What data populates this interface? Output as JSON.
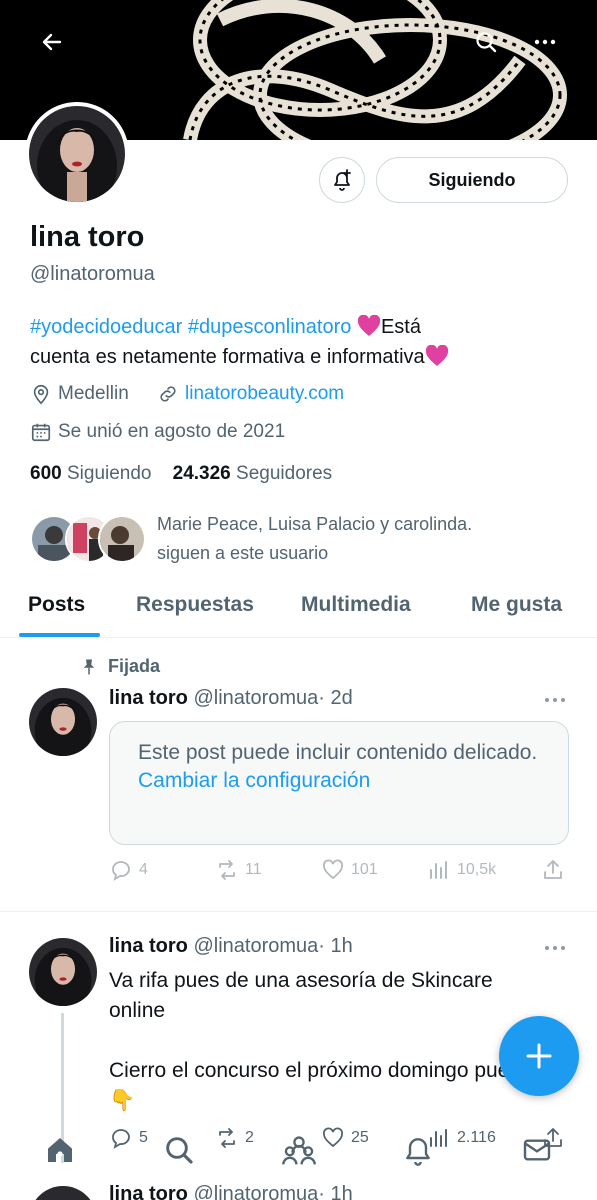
{
  "profile": {
    "name": "lina toro",
    "handle": "@linatoromua",
    "following_button": "Siguiendo",
    "bio_tag1": "#yodecidoeducar",
    "bio_tag2": "#dupesconlinatoro",
    "bio_text1": "Está",
    "bio_text2": "cuenta es netamente formativa e informativa",
    "location": "Medellin",
    "website": "linatorobeauty.com",
    "joined": "Se unió en agosto de 2021",
    "following_count": "600",
    "following_label": "Siguiendo",
    "followers_count": "24.326",
    "followers_label": "Seguidores",
    "followers_you_know_line1": "Marie Peace, Luisa Palacio y carolinda.",
    "followers_you_know_line2": "siguen a este usuario"
  },
  "tabs": [
    "Posts",
    "Respuestas",
    "Multimedia",
    "Me gusta"
  ],
  "posts": [
    {
      "pinned_label": "Fijada",
      "name": "lina toro",
      "handle": "@linatoromua",
      "time": "· 2d",
      "sensitive_text": "Este post puede incluir contenido delicado.",
      "sensitive_action": "Cambiar la configuración",
      "replies": "4",
      "reposts": "11",
      "likes": "101",
      "views": "10,5k"
    },
    {
      "name": "lina toro",
      "handle": "@linatoromua",
      "time": "· 1h",
      "text_line1": "Va rifa pues de una asesoría de Skincare online",
      "text_line2": "Cierro el concurso el próximo domingo pues 👇",
      "replies": "5",
      "reposts": "2",
      "likes": "25",
      "views": "2.116"
    },
    {
      "name": "lina toro",
      "handle": "@linatoromua",
      "time": "· 1h"
    }
  ],
  "colors": {
    "accent": "#1d9bf0",
    "text": "#0f1419",
    "secondary": "#536471",
    "heart": "#e040a0"
  },
  "icons": {
    "back": "arrow-left-icon",
    "search": "search-icon",
    "more": "more-icon",
    "notify": "bell-plus-icon",
    "location": "location-pin-icon",
    "link": "link-icon",
    "calendar": "calendar-icon",
    "pin": "pin-icon",
    "reply": "reply-icon",
    "repost": "repost-icon",
    "like": "heart-icon",
    "views": "views-icon",
    "share": "share-icon",
    "compose": "plus-icon",
    "home": "home-icon",
    "communities": "people-icon",
    "notifications": "bell-icon",
    "messages": "mail-icon"
  }
}
